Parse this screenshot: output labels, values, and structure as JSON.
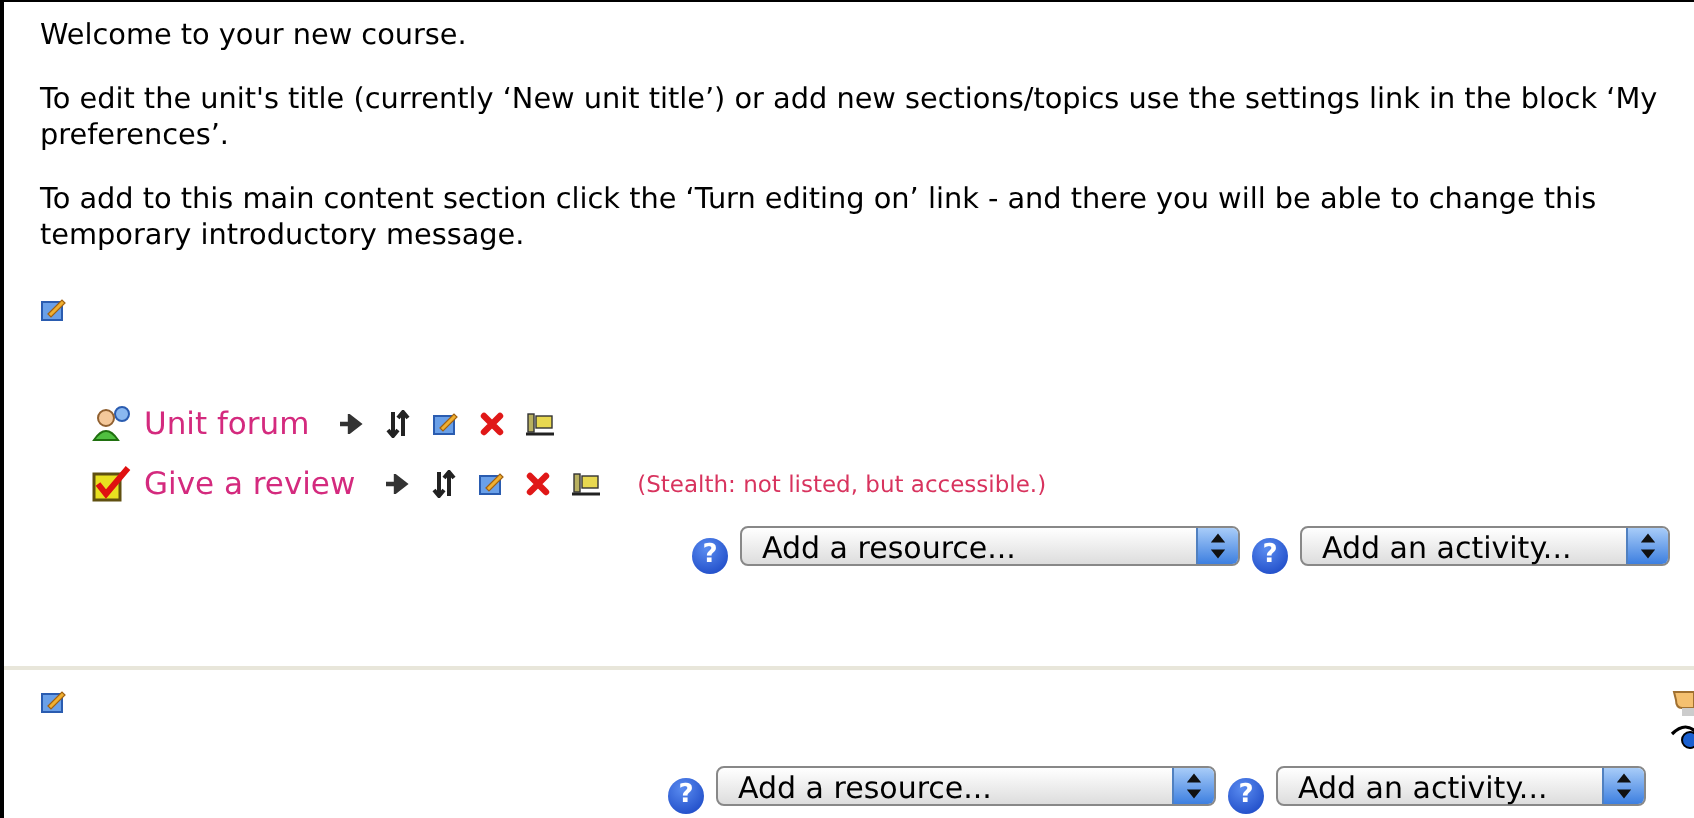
{
  "intro": [
    "Welcome to your new course.",
    "To edit the unit's title (currently ‘New unit title’) or add new sections/topics use the settings link in the block ‘My preferences’.",
    "To add to this main content section click the ‘Turn editing on’ link - and there you will be able to change this temporary introductory message."
  ],
  "sections": [
    {
      "activities": [
        {
          "kind": "forum",
          "name": "Unit forum"
        },
        {
          "kind": "quiz",
          "name": "Give a review",
          "note": "(Stealth: not listed, but accessible.)"
        }
      ],
      "resource_help": "?",
      "resource_select": "Add a resource...",
      "activity_help": "?",
      "activity_select": "Add an activity..."
    },
    {
      "resource_help": "?",
      "resource_select": "Add a resource...",
      "activity_help": "?",
      "activity_select": "Add an activity..."
    }
  ]
}
